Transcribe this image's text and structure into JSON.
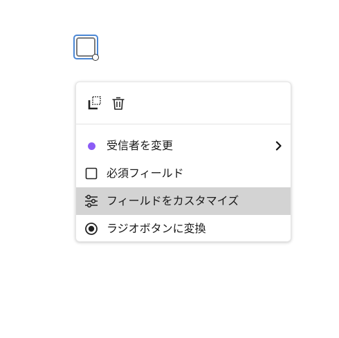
{
  "canvas": {
    "field_selected": true
  },
  "menu": {
    "toolbar": {
      "duplicate_icon": "duplicate-icon",
      "delete_icon": "trash-icon"
    },
    "items": [
      {
        "label": "受信者を変更",
        "icon": "recipient-dot-icon",
        "color": "#8b5cf6",
        "has_submenu": true
      },
      {
        "label": "必須フィールド",
        "icon": "checkbox-icon",
        "checked": false
      },
      {
        "label": "フィールドをカスタマイズ",
        "icon": "sliders-icon",
        "highlighted": true
      },
      {
        "label": "ラジオボタンに変換",
        "icon": "radio-icon"
      }
    ]
  }
}
